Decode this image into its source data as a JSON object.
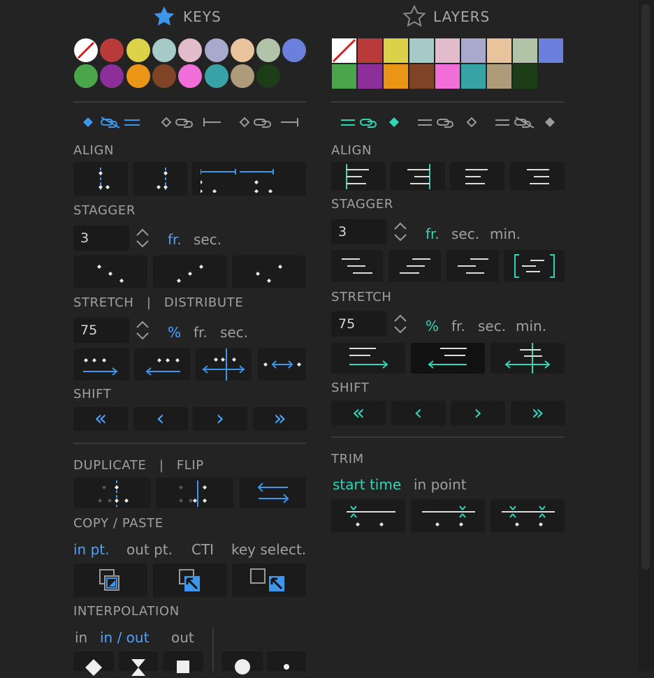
{
  "colors": {
    "blue": "#4aa3ff",
    "teal": "#2fd6b8",
    "swatches": [
      "none",
      "#b83a3a",
      "#dcd24a",
      "#a6cac8",
      "#e2bccb",
      "#a7a9cd",
      "#e9c39c",
      "#b2c4a8",
      "#6b7fdc",
      "#4aa64a",
      "#8c2f9a",
      "#ea9515",
      "#7f4426",
      "#f16ed8",
      "#38a3a6",
      "#ae9b79",
      "#1d3d19"
    ]
  },
  "keys": {
    "header": {
      "title": "KEYS",
      "icon": "star-filled-icon"
    },
    "align": {
      "label": "ALIGN"
    },
    "stagger": {
      "label": "STAGGER",
      "value": "3",
      "units": [
        "fr.",
        "sec."
      ],
      "active_unit": "fr."
    },
    "stretch": {
      "label": "STRETCH",
      "separator": "|",
      "label2": "DISTRIBUTE",
      "value": "75",
      "units": [
        "%",
        "fr.",
        "sec."
      ],
      "active_unit": "%"
    },
    "shift": {
      "label": "SHIFT",
      "buttons": [
        "«",
        "‹",
        "›",
        "»"
      ]
    },
    "duplicate": {
      "label": "DUPLICATE",
      "separator": "|",
      "label2": "FLIP"
    },
    "copy_paste": {
      "label": "COPY / PASTE",
      "options": [
        "in pt.",
        "out pt.",
        "CTI",
        "key select."
      ],
      "active": "in pt."
    },
    "interpolation": {
      "label": "INTERPOLATION",
      "options": [
        "in",
        "in / out",
        "out"
      ],
      "active": "in / out"
    }
  },
  "layers": {
    "header": {
      "title": "LAYERS",
      "icon": "star-outline-icon"
    },
    "align": {
      "label": "ALIGN"
    },
    "stagger": {
      "label": "STAGGER",
      "value": "3",
      "units": [
        "fr.",
        "sec.",
        "min."
      ],
      "active_unit": "fr."
    },
    "stretch": {
      "label": "STRETCH",
      "value": "75",
      "units": [
        "%",
        "fr.",
        "sec.",
        "min."
      ],
      "active_unit": "%"
    },
    "shift": {
      "label": "SHIFT",
      "buttons": [
        "«",
        "‹",
        "›",
        "»"
      ]
    },
    "trim": {
      "label": "TRIM",
      "options": [
        "start time",
        "in point"
      ],
      "active": "start time"
    }
  }
}
